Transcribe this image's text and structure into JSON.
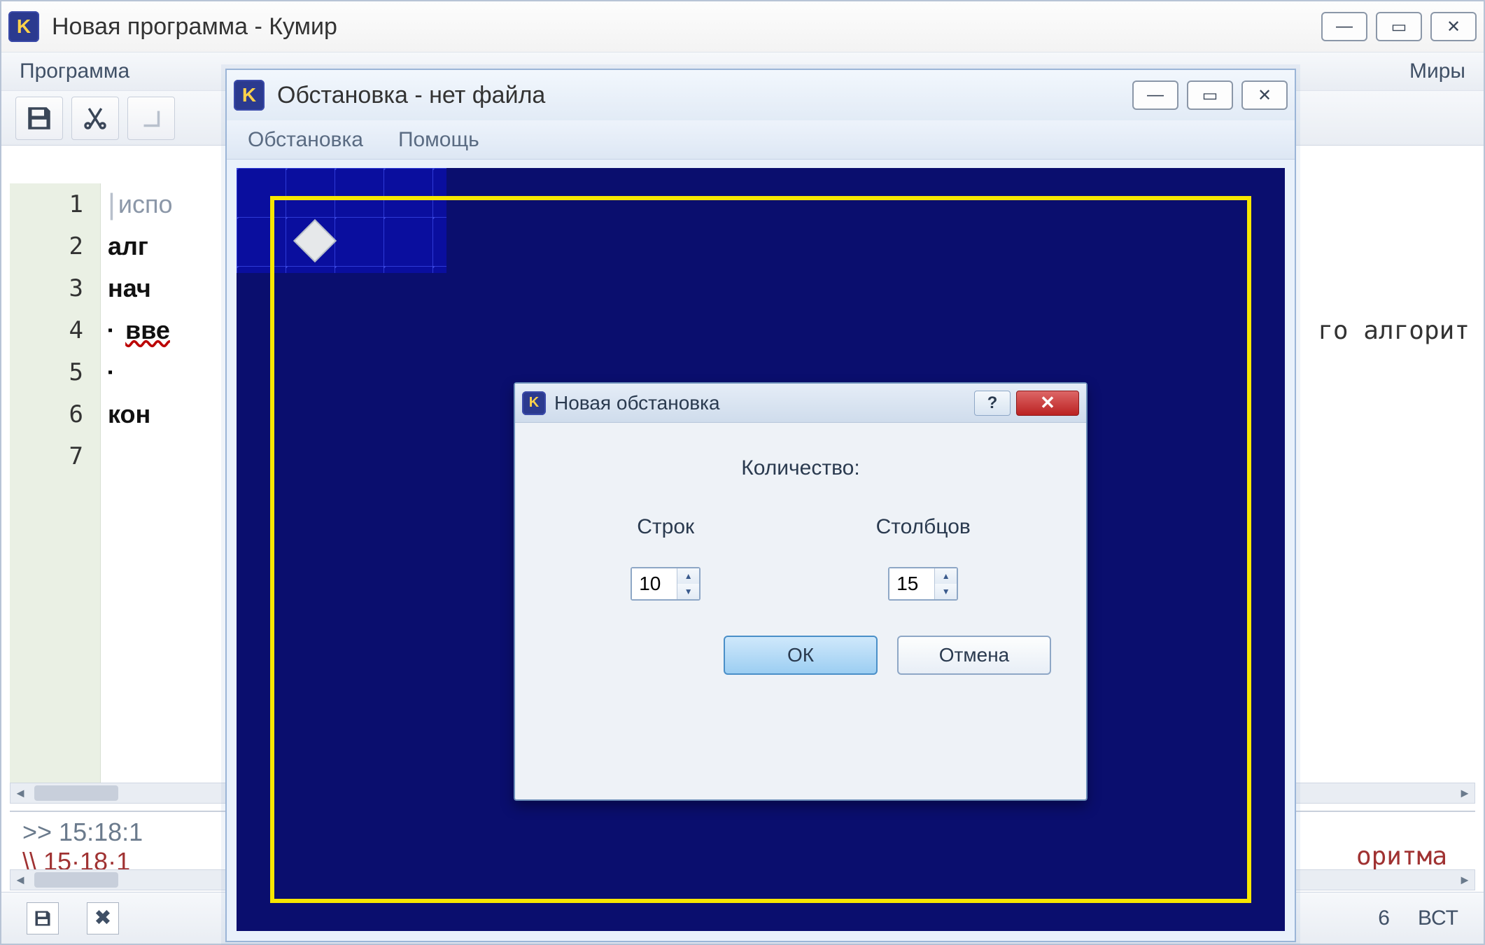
{
  "main": {
    "title": "Новая программа - Кумир",
    "menu": {
      "program": "Программа",
      "worlds": "Миры"
    }
  },
  "editor": {
    "lines": [
      "1",
      "2",
      "3",
      "4",
      "5",
      "6",
      "7"
    ],
    "l1": "испо",
    "l2": "алг",
    "l3": "нач",
    "l4": "вве",
    "l6": "кон",
    "right_fragment": "го алгорит"
  },
  "console": {
    "line1": ">> 15:18:1",
    "line2": "\\\\ 15·18·1",
    "right_fragment": "оритма"
  },
  "status": {
    "num": "6",
    "ins": "ВСТ"
  },
  "robot": {
    "title": "Обстановка - нет файла",
    "menu": {
      "env": "Обстановка",
      "help": "Помощь"
    }
  },
  "dialog": {
    "title": "Новая обстановка",
    "heading": "Количество:",
    "rows_label": "Строк",
    "cols_label": "Столбцов",
    "rows_value": "10",
    "cols_value": "15",
    "ok": "ОК",
    "cancel": "Отмена"
  }
}
